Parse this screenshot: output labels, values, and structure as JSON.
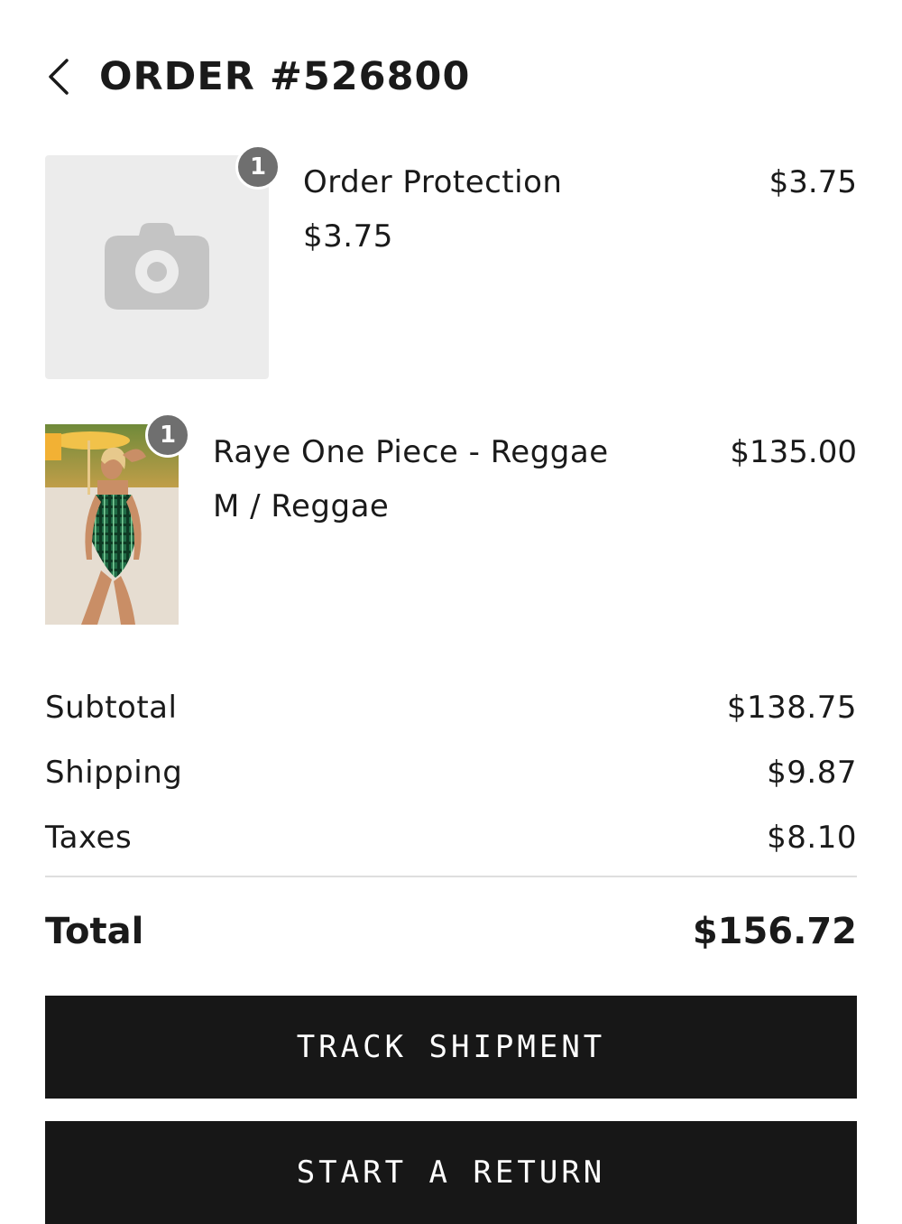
{
  "header": {
    "title": "ORDER #526800",
    "back_icon": "chevron-left-icon"
  },
  "items": [
    {
      "name": "Order Protection",
      "variant": "$3.75",
      "price": "$3.75",
      "quantity": "1",
      "image": "camera-placeholder-icon"
    },
    {
      "name": "Raye One Piece - Reggae",
      "variant": "M / Reggae",
      "price": "$135.00",
      "quantity": "1",
      "image": "product-photo"
    }
  ],
  "summary": {
    "subtotal_label": "Subtotal",
    "subtotal_value": "$138.75",
    "shipping_label": "Shipping",
    "shipping_value": "$9.87",
    "taxes_label": "Taxes",
    "taxes_value": "$8.10",
    "total_label": "Total",
    "total_value": "$156.72"
  },
  "actions": {
    "track_label": "TRACK SHIPMENT",
    "return_label": "START A RETURN"
  },
  "colors": {
    "button_bg": "#171717",
    "badge_bg": "#6f6f6f",
    "placeholder_bg": "#ececec"
  }
}
